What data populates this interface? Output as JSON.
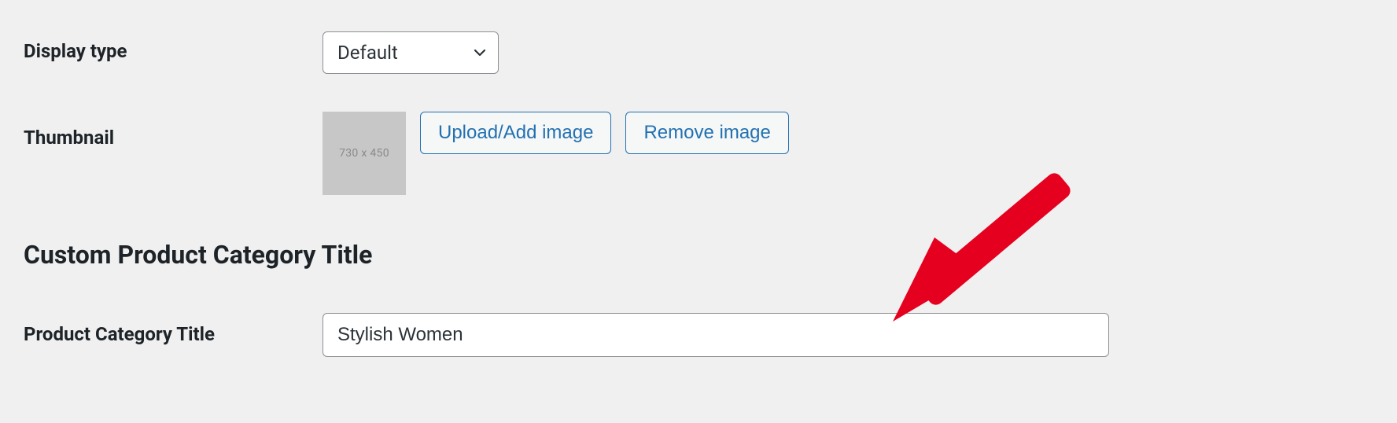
{
  "display_type": {
    "label": "Display type",
    "selected": "Default"
  },
  "thumbnail": {
    "label": "Thumbnail",
    "placeholder_text": "730 x 450",
    "upload_button": "Upload/Add image",
    "remove_button": "Remove image"
  },
  "section_heading": "Custom Product Category Title",
  "category_title": {
    "label": "Product Category Title",
    "value": "Stylish Women"
  }
}
